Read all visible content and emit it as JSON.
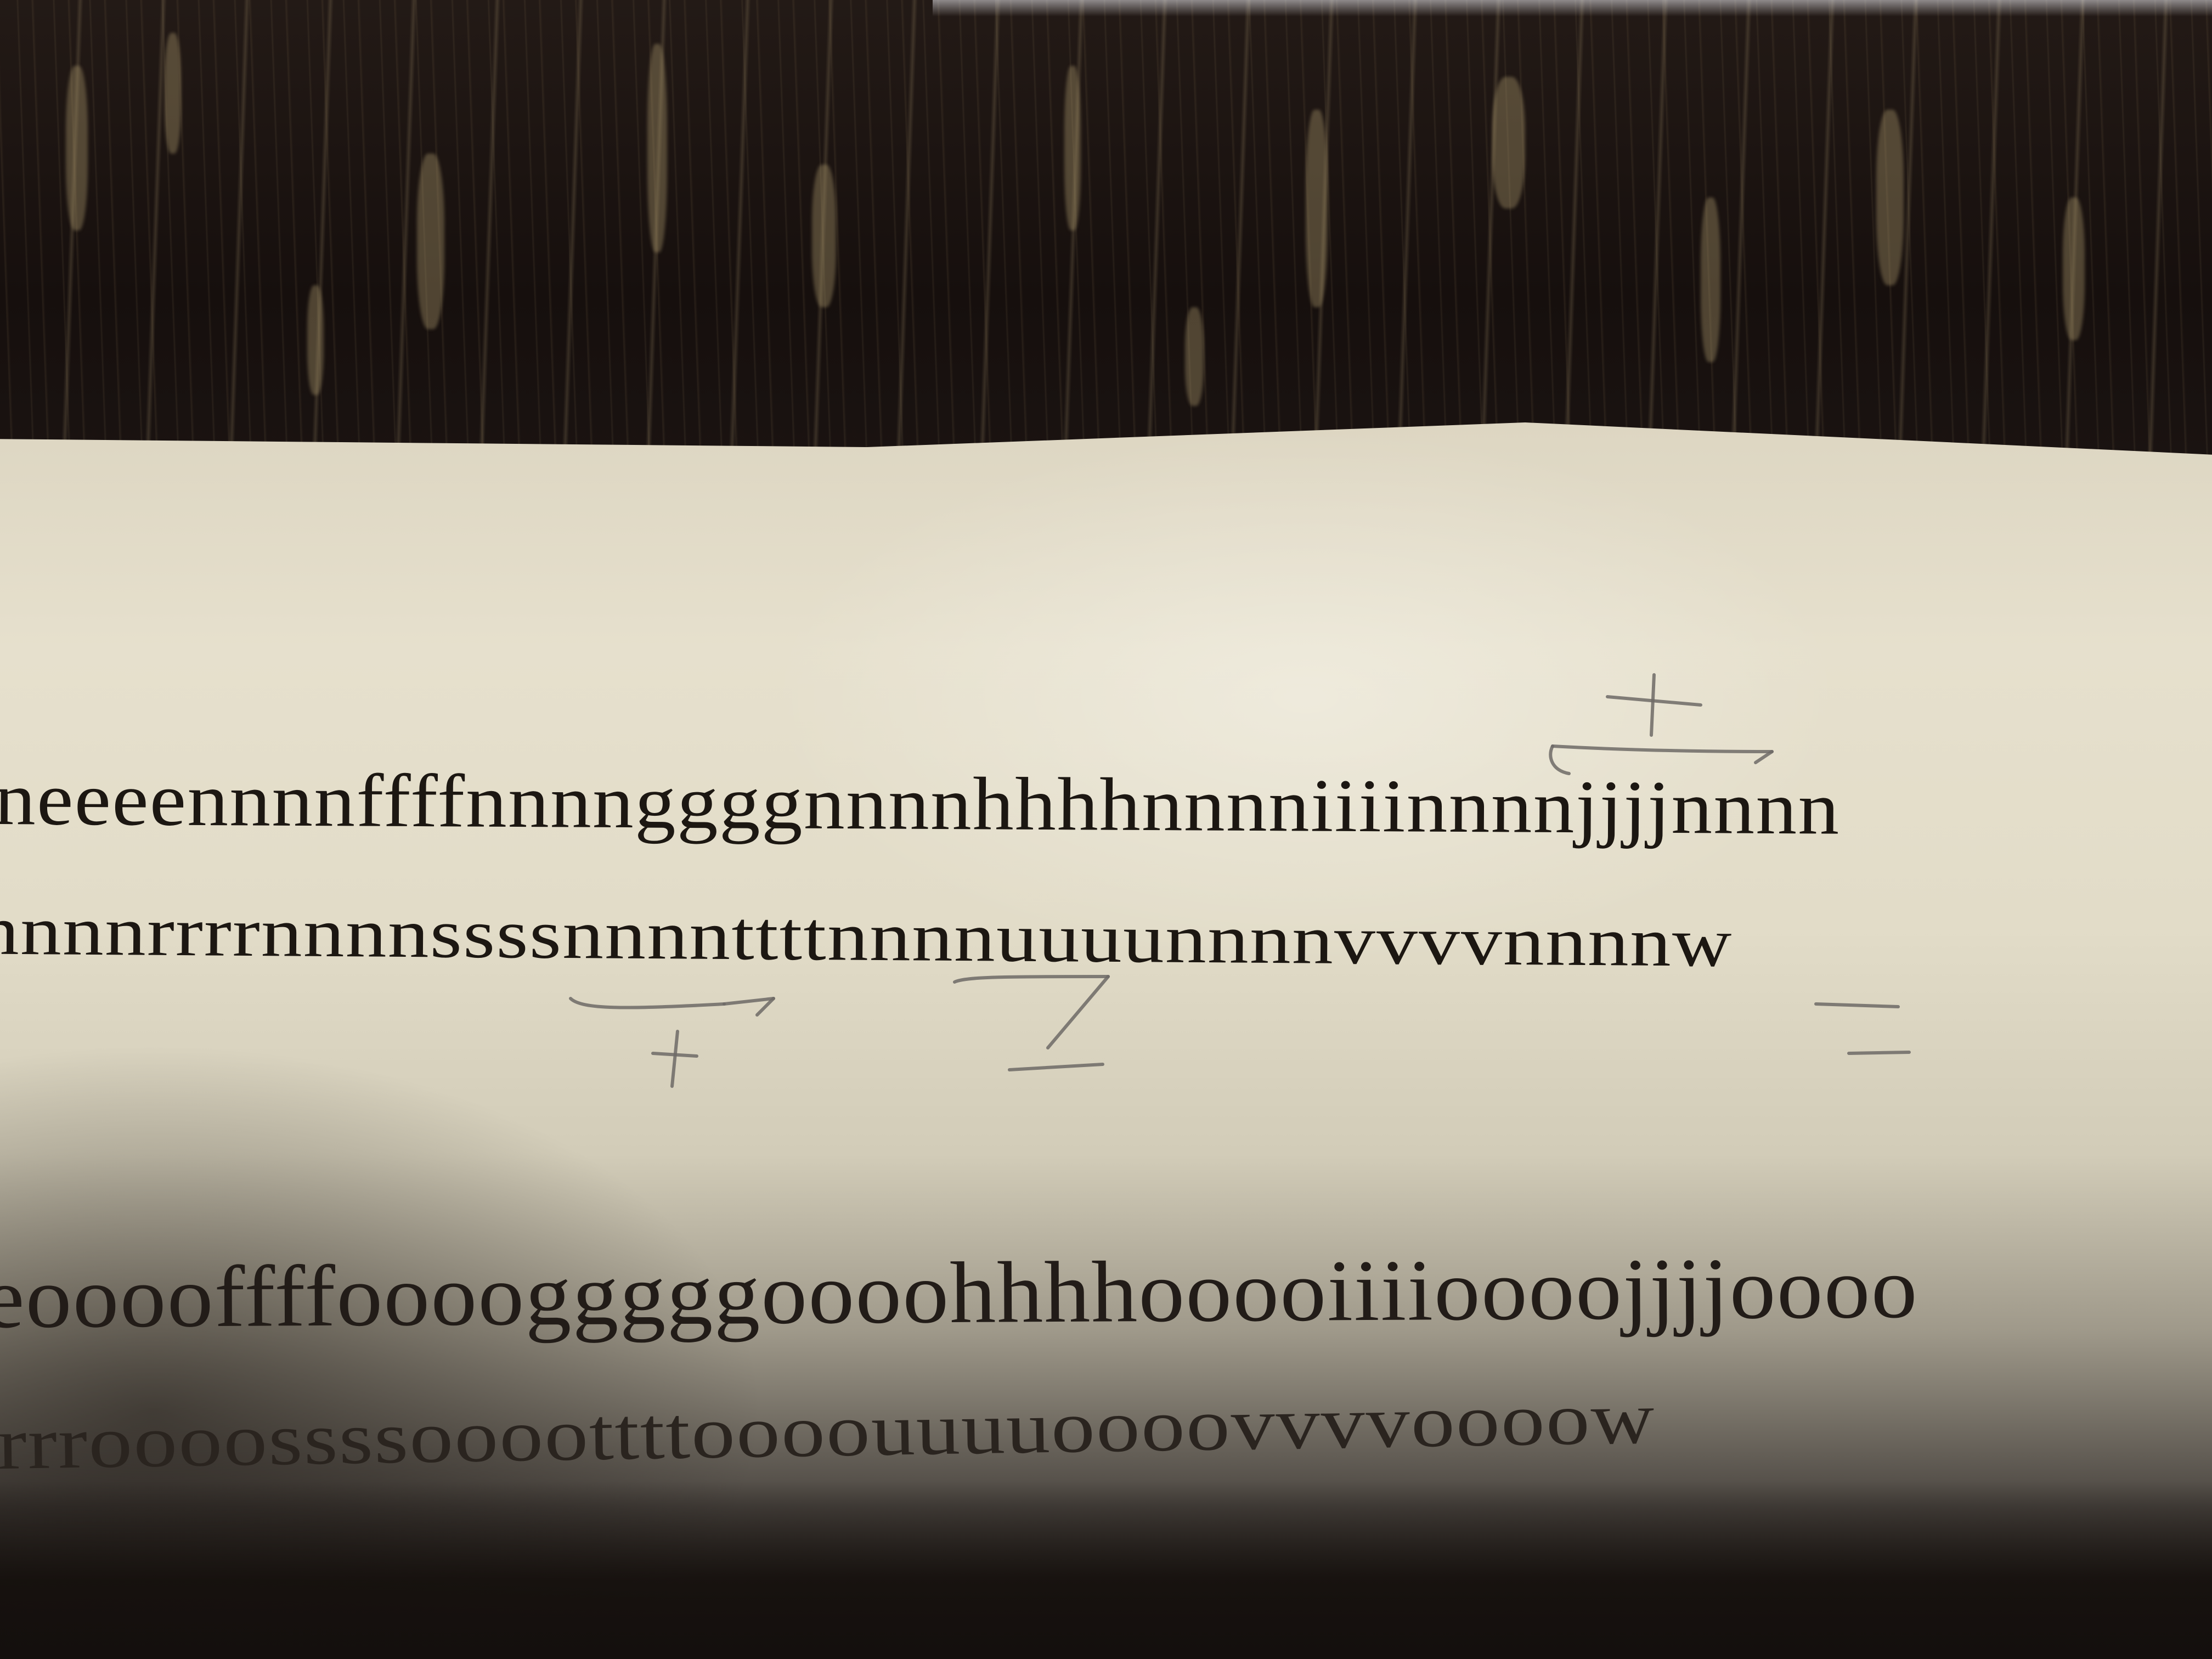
{
  "printed_lines": [
    "neeeennnnffffnnnnggggnnnnhhhhnnnniiiinnnnjjjjnnnn",
    "nnnnrrrrnnnnssssnnnnttttnnnnuuuunnnnvvvvnnnnw",
    "eooooffffoooogggggoooohhhhooooiiiioooojjjjoooo",
    "rrrroooossssoooottttoooouuuuoooovvvvoooow"
  ],
  "pencil_annotations": [
    {
      "mark": "+",
      "near": "iiii (line 1)"
    },
    {
      "mark": "+",
      "near": "ssss (line 2)"
    },
    {
      "mark": "−",
      "near": "tttt (line 2)"
    },
    {
      "mark": "=",
      "near": "vvvv (line 2)"
    }
  ],
  "colors": {
    "ink": "#1c1712",
    "pencil": "#6d6a66",
    "paper": "#e2dcc8",
    "table": "#1b1412"
  }
}
